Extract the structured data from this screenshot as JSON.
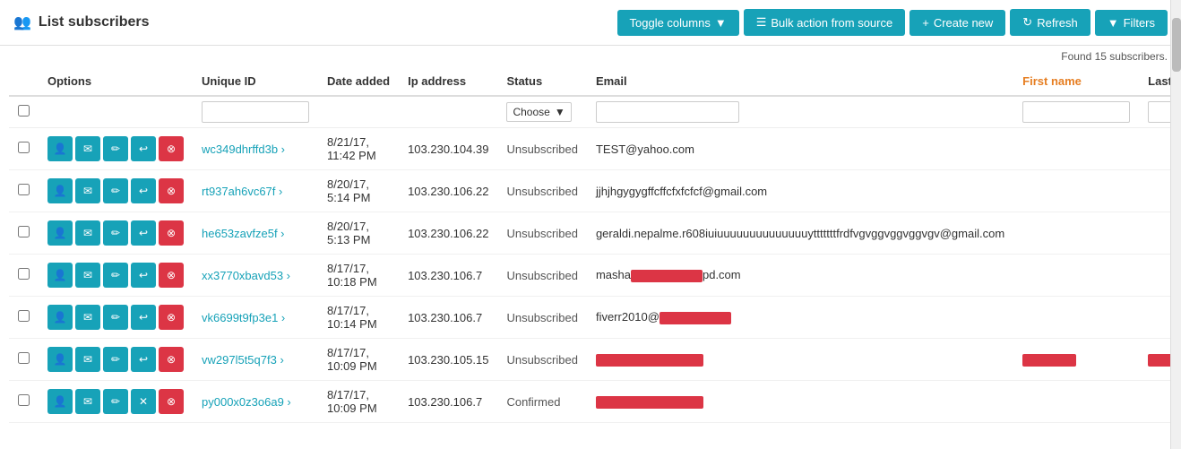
{
  "header": {
    "title": "List subscribers",
    "icon": "👥",
    "buttons": [
      {
        "label": "Toggle columns",
        "icon": "▼",
        "type": "toggle",
        "key": "toggle-columns"
      },
      {
        "label": "Bulk action from source",
        "icon": "☰",
        "type": "bulk",
        "key": "bulk-action"
      },
      {
        "label": "Create new",
        "icon": "+",
        "type": "create",
        "key": "create-new"
      },
      {
        "label": "Refresh",
        "icon": "↻",
        "type": "refresh",
        "key": "refresh"
      },
      {
        "label": "Filters",
        "icon": "▼",
        "type": "filter",
        "key": "filters"
      }
    ]
  },
  "found_info": "Found 15 subscribers.",
  "columns": [
    {
      "key": "options",
      "label": "Options",
      "orange": false
    },
    {
      "key": "unique_id",
      "label": "Unique ID",
      "orange": false
    },
    {
      "key": "date_added",
      "label": "Date added",
      "orange": false
    },
    {
      "key": "ip_address",
      "label": "Ip address",
      "orange": false
    },
    {
      "key": "status",
      "label": "Status",
      "orange": false
    },
    {
      "key": "email",
      "label": "Email",
      "orange": false
    },
    {
      "key": "first_name",
      "label": "First name",
      "orange": true
    },
    {
      "key": "last_name",
      "label": "Last name",
      "orange": false
    }
  ],
  "filter_row": {
    "unique_id_placeholder": "",
    "status_placeholder": "Choose",
    "email_placeholder": "",
    "first_name_placeholder": "",
    "last_name_placeholder": ""
  },
  "rows": [
    {
      "id": "wc349dhrffd3b",
      "date_added": "8/21/17, 11:42 PM",
      "ip_address": "103.230.104.39",
      "status": "Unsubscribed",
      "email": "TEST@yahoo.com",
      "first_name": "",
      "last_name": "",
      "confirmed": false,
      "has_x": false
    },
    {
      "id": "rt937ah6vc67f",
      "date_added": "8/20/17, 5:14 PM",
      "ip_address": "103.230.106.22",
      "status": "Unsubscribed",
      "email": "jjhjhgygygffcffcfxfcfcf@gmail.com",
      "first_name": "",
      "last_name": "",
      "confirmed": false,
      "has_x": false
    },
    {
      "id": "he653zavfze5f",
      "date_added": "8/20/17, 5:13 PM",
      "ip_address": "103.230.106.22",
      "status": "Unsubscribed",
      "email": "geraldi.nepalme.r608iuiuuuuuuuuuuuuuuytttttttfrdfvgvggvggvggvgv@gmail.com",
      "first_name": "",
      "last_name": "",
      "confirmed": false,
      "has_x": false
    },
    {
      "id": "xx3770xbavd53",
      "date_added": "8/17/17, 10:18 PM",
      "ip_address": "103.230.106.7",
      "status": "Unsubscribed",
      "email_prefix": "masha",
      "email_suffix": "pd.com",
      "email_redacted": true,
      "first_name": "",
      "last_name": "",
      "confirmed": false,
      "has_x": false
    },
    {
      "id": "vk6699t9fp3e1",
      "date_added": "8/17/17, 10:14 PM",
      "ip_address": "103.230.106.7",
      "status": "Unsubscribed",
      "email_prefix": "fiverr2010@",
      "email_suffix": "",
      "email_redacted": true,
      "first_name": "",
      "last_name": "",
      "confirmed": false,
      "has_x": false
    },
    {
      "id": "vw297l5t5q7f3",
      "date_added": "8/17/17, 10:09 PM",
      "ip_address": "103.230.105.15",
      "status": "Unsubscribed",
      "email_redacted_full": true,
      "first_name_redacted": true,
      "last_name_redacted": true,
      "confirmed": false,
      "has_x": false
    },
    {
      "id": "py000x0z3o6a9",
      "date_added": "8/17/17, 10:09 PM",
      "ip_address": "103.230.106.7",
      "status": "Confirmed",
      "email_redacted_full": true,
      "first_name": "",
      "last_name": "",
      "confirmed": true,
      "has_x": true
    }
  ],
  "icons": {
    "user": "👤",
    "email": "✉",
    "edit": "✏",
    "arrow": "↩",
    "delete": "⊗",
    "x": "✕"
  }
}
